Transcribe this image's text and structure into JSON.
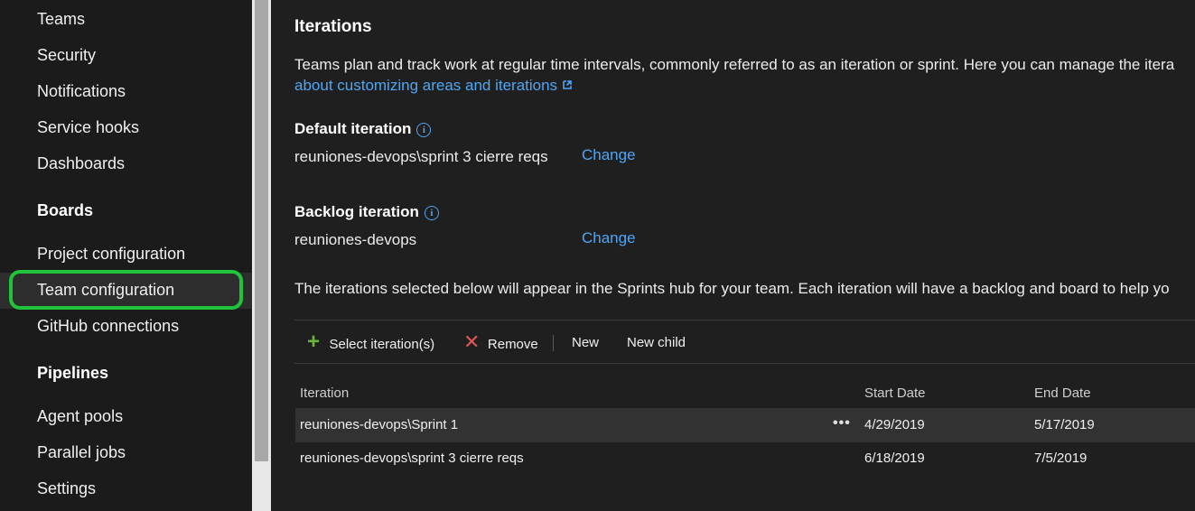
{
  "sidebar": {
    "items_top": [
      "Teams",
      "Security",
      "Notifications",
      "Service hooks",
      "Dashboards"
    ],
    "boards_header": "Boards",
    "boards_items": [
      "Project configuration",
      "Team configuration",
      "GitHub connections"
    ],
    "pipelines_header": "Pipelines",
    "pipelines_items": [
      "Agent pools",
      "Parallel jobs",
      "Settings"
    ],
    "selected": "Team configuration",
    "highlight_color": "#1fc43a"
  },
  "main": {
    "title": "Iterations",
    "description": "Teams plan and track work at regular time intervals, commonly referred to as an iteration or sprint. Here you can manage the itera",
    "learn_more_link": "about customizing areas and iterations",
    "default_iteration": {
      "label": "Default iteration",
      "value": "reuniones-devops\\sprint 3 cierre reqs",
      "change_label": "Change"
    },
    "backlog_iteration": {
      "label": "Backlog iteration",
      "value": "reuniones-devops",
      "change_label": "Change"
    },
    "iterations_note": "The iterations selected below will appear in the Sprints hub for your team. Each iteration will have a backlog and board to help yo",
    "toolbar": {
      "select_label": "Select iteration(s)",
      "remove_label": "Remove",
      "new_label": "New",
      "new_child_label": "New child"
    },
    "table": {
      "columns": [
        "Iteration",
        "Start Date",
        "End Date"
      ],
      "rows": [
        {
          "iteration": "reuniones-devops\\Sprint 1",
          "start": "4/29/2019",
          "end": "5/17/2019",
          "more": "•••"
        },
        {
          "iteration": "reuniones-devops\\sprint 3 cierre reqs",
          "start": "6/18/2019",
          "end": "7/5/2019"
        }
      ]
    }
  },
  "colors": {
    "link": "#4ea6f5",
    "add_icon": "#6bb43a",
    "remove_icon": "#e05555"
  }
}
